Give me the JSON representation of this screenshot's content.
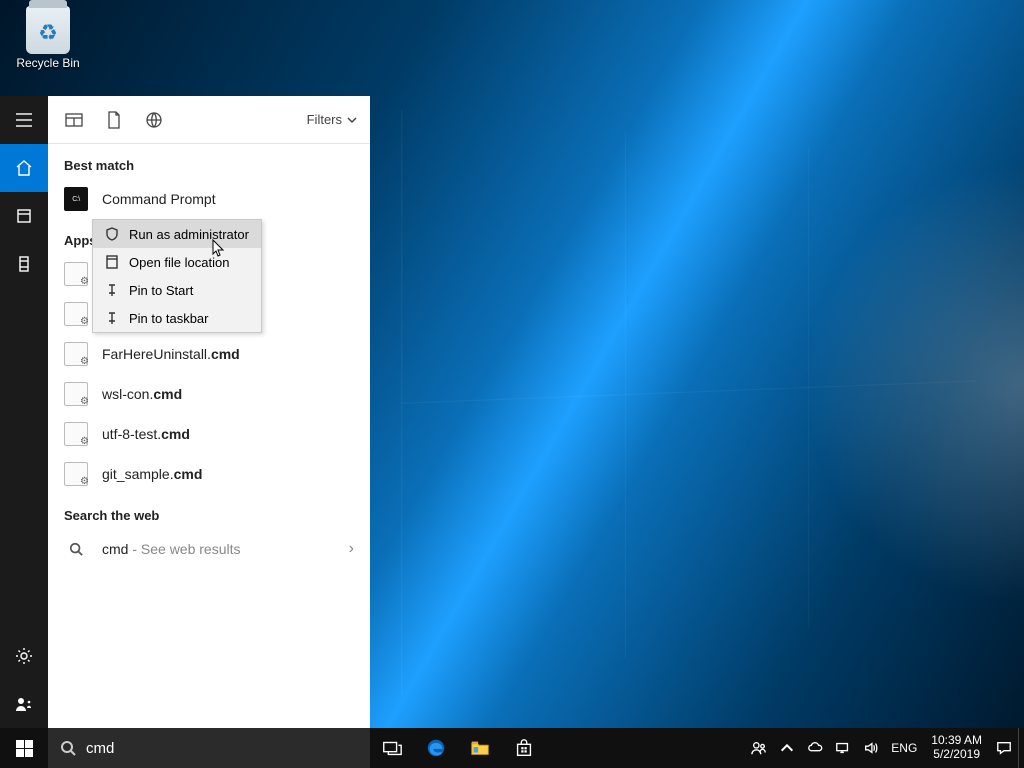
{
  "desktop": {
    "recycle_bin": "Recycle Bin"
  },
  "search": {
    "filters_label": "Filters",
    "best_match_label": "Best match",
    "best_match_item": "Command Prompt",
    "apps_label": "Apps",
    "app_items": [
      "FarHereUninstall.<b>cmd</b>",
      "wsl-con.<b>cmd</b>",
      "utf-8-test.<b>cmd</b>",
      "git_sample.<b>cmd</b>"
    ],
    "web_label": "Search the web",
    "web_query": "cmd",
    "web_hint": " - See web results",
    "query": "cmd"
  },
  "context_menu": {
    "items": [
      "Run as administrator",
      "Open file location",
      "Pin to Start",
      "Pin to taskbar"
    ]
  },
  "tray": {
    "lang": "ENG",
    "time": "10:39 AM",
    "date": "5/2/2019"
  }
}
